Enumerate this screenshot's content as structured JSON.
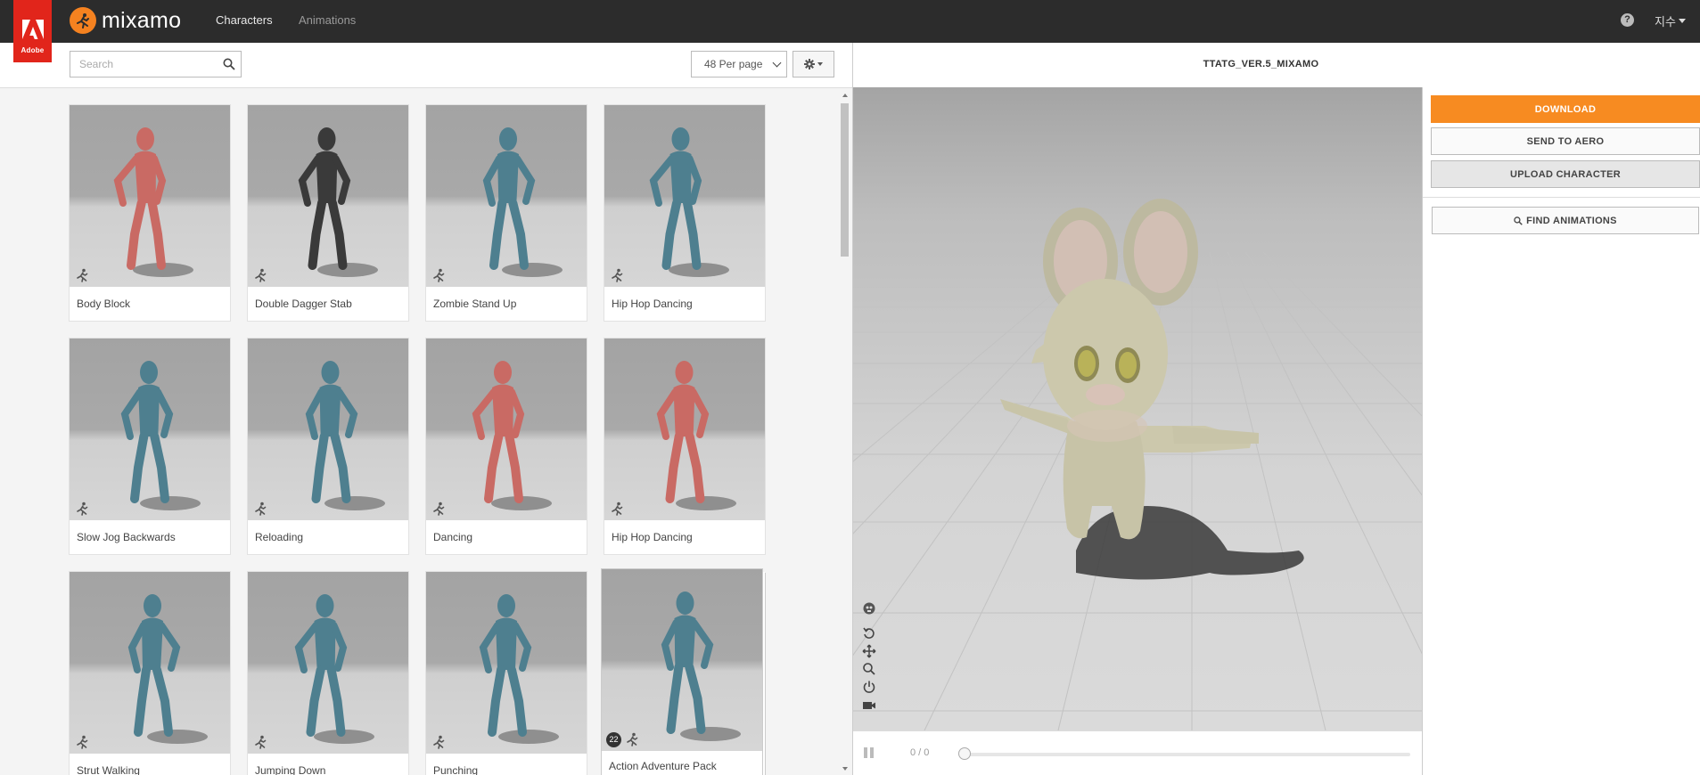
{
  "adobe": {
    "label": "Adobe"
  },
  "brand": {
    "name": "mixamo"
  },
  "nav": {
    "characters": "Characters",
    "animations": "Animations"
  },
  "user": {
    "name": "지수"
  },
  "search": {
    "placeholder": "Search"
  },
  "per_page": {
    "selected": "48 Per page"
  },
  "cards": [
    {
      "label": "Body Block",
      "color": "#c96a64"
    },
    {
      "label": "Double Dagger Stab",
      "color": "#3a3a3a"
    },
    {
      "label": "Zombie Stand Up",
      "color": "#4e7f8f"
    },
    {
      "label": "Hip Hop Dancing",
      "color": "#4e7f8f"
    },
    {
      "label": "Slow Jog Backwards",
      "color": "#4e7f8f"
    },
    {
      "label": "Reloading",
      "color": "#4e7f8f"
    },
    {
      "label": "Dancing",
      "color": "#c96a64"
    },
    {
      "label": "Hip Hop Dancing",
      "color": "#c96a64"
    },
    {
      "label": "Strut Walking",
      "color": "#4e7f8f"
    },
    {
      "label": "Jumping Down",
      "color": "#4e7f8f"
    },
    {
      "label": "Punching",
      "color": "#4e7f8f"
    },
    {
      "label": "Action Adventure Pack",
      "color": "#4e7f8f",
      "count": "22"
    }
  ],
  "viewer": {
    "title": "TTATG_VER.5_MIXAMO",
    "frame_counter": "0 / 0",
    "progress": 0
  },
  "actions": {
    "download": "DOWNLOAD",
    "send_to_aero": "SEND TO AERO",
    "upload_character": "UPLOAD CHARACTER",
    "find_animations": "FIND ANIMATIONS"
  },
  "colors": {
    "accent": "#f78b21",
    "adobe_red": "#e1251b",
    "topbar": "#2c2c2c"
  }
}
